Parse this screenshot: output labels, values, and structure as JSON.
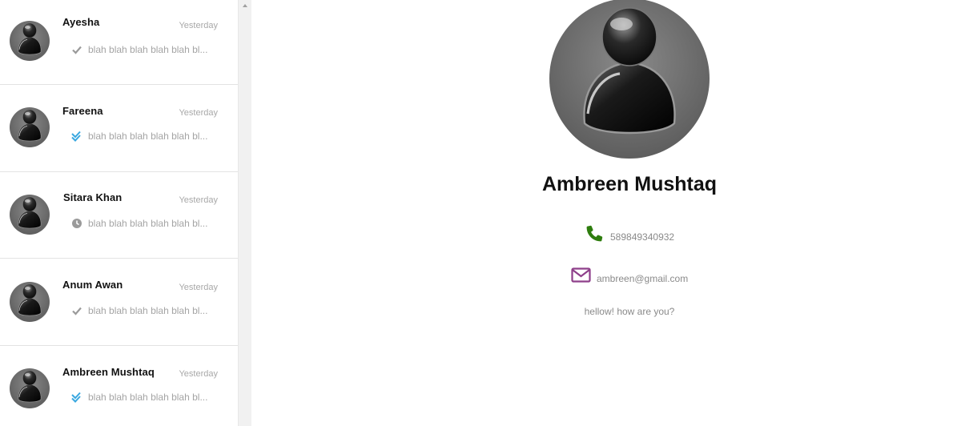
{
  "chats": [
    {
      "name": "Ayesha",
      "time": "Yesterday",
      "status": "sent-check-icon",
      "preview": "blah blah blah blah blah bl..."
    },
    {
      "name": "Fareena",
      "time": "Yesterday",
      "status": "read-double-check-icon",
      "preview": "blah blah blah blah blah bl..."
    },
    {
      "name": "Sitara Khan",
      "time": "Yesterday",
      "status": "pending-clock-icon",
      "preview": "blah blah blah blah blah bl..."
    },
    {
      "name": "Anum Awan",
      "time": "Yesterday",
      "status": "sent-check-icon",
      "preview": "blah blah blah blah blah bl..."
    },
    {
      "name": "Ambreen Mushtaq",
      "time": "Yesterday",
      "status": "read-double-check-icon",
      "preview": "blah blah blah blah blah bl..."
    }
  ],
  "profile": {
    "name": "Ambreen Mushtaq",
    "phone": "589849340932",
    "email": "ambreen@gmail.com",
    "status_message": "hellow! how are you?"
  },
  "colors": {
    "phone_icon": "#2e7d0e",
    "mail_icon": "#8e3f8a",
    "read_check": "#3aa8e0",
    "sent_check": "#9a9a9a"
  }
}
